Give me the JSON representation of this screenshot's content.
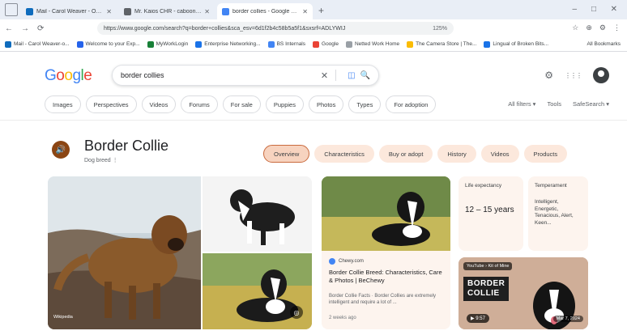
{
  "browser": {
    "tabs": [
      {
        "title": "Mail - Carol Weaver - Outlook",
        "fav_color": "#0f6cbd",
        "active": false
      },
      {
        "title": "Mr. Kaios CHR - caboon76x3/git/",
        "fav_color": "#5f6368",
        "active": false
      },
      {
        "title": "border collies - Google Search",
        "fav_color": "#4285f4",
        "active": true
      }
    ],
    "new_tab": "+",
    "window_controls": [
      "–",
      "□",
      "✕"
    ],
    "nav": {
      "back": "←",
      "forward": "→",
      "reload": "⟳"
    },
    "address": "https://www.google.com/search?q=border+collies&sca_esv=6d1f2b4c58b5a5f1&sxsrf=ADLYWIJ",
    "zoom": "125%",
    "toolbar_icons": [
      "☆",
      "⊕",
      "⚙",
      "⋮"
    ],
    "bookmarks": [
      {
        "label": "Mail - Carol Weaver-o...",
        "fav_color": "#0f6cbd"
      },
      {
        "label": "Welcome to your Exp...",
        "fav_color": "#2563eb"
      },
      {
        "label": "MyWorkLogin",
        "fav_color": "#188038"
      },
      {
        "label": "Enterprise Networking...",
        "fav_color": "#1a73e8"
      },
      {
        "label": "BS Internals",
        "fav_color": "#4285f4"
      },
      {
        "label": "Google",
        "fav_color": "#ea4335"
      },
      {
        "label": "Netted Work Home",
        "fav_color": "#9aa0a6"
      },
      {
        "label": "The Camera Store | The...",
        "fav_color": "#fbbc04"
      },
      {
        "label": "Lingual of Broken Bits...",
        "fav_color": "#1a73e8"
      }
    ],
    "all_bookmarks": "All Bookmarks"
  },
  "google": {
    "logo_letters": [
      {
        "ch": "G",
        "color": "#4285f4"
      },
      {
        "ch": "o",
        "color": "#ea4335"
      },
      {
        "ch": "o",
        "color": "#fbbc05"
      },
      {
        "ch": "g",
        "color": "#4285f4"
      },
      {
        "ch": "l",
        "color": "#34a853"
      },
      {
        "ch": "e",
        "color": "#ea4335"
      }
    ],
    "query": "border collies",
    "clear_icon": "✕",
    "lens_icon": "◫",
    "search_icon": "🔍",
    "settings_icon": "⚙",
    "apps_icon": "⋮⋮⋮"
  },
  "filters": [
    "Images",
    "Perspectives",
    "Videos",
    "Forums",
    "For sale",
    "Puppies",
    "Photos",
    "Types",
    "For adoption"
  ],
  "tools": {
    "all_filters": "All filters ▾",
    "tools": "Tools",
    "safesearch": "SafeSearch ▾"
  },
  "knowledge": {
    "title": "Border Collie",
    "subtitle": "Dog breed  ⋮",
    "speaker_icon": "🔊",
    "tabs": [
      "Overview",
      "Characteristics",
      "Buy or adopt",
      "History",
      "Videos",
      "Products"
    ],
    "photo_credit": "Wikipedia",
    "article": {
      "source": "Chewy.com",
      "headline": "Border Collie Breed: Characteristics, Care & Photos | BeChewy",
      "snippet": "Border Collie Facts · Border Collies are extremely intelligent and require a lot of ...",
      "time": "2 weeks ago"
    },
    "facts": [
      {
        "label": "Life expectancy",
        "value": "12 – 15 years"
      },
      {
        "label": "Temperament",
        "value": "Intelligent, Energetic, Tenacious, Alert, Keen..."
      }
    ],
    "video": {
      "channel": "YouTube › Kit of Mine",
      "title_lines": "BORDER\nCOLLIE",
      "duration": "▶ 9:57",
      "date": "Mar 7, 2024"
    }
  }
}
